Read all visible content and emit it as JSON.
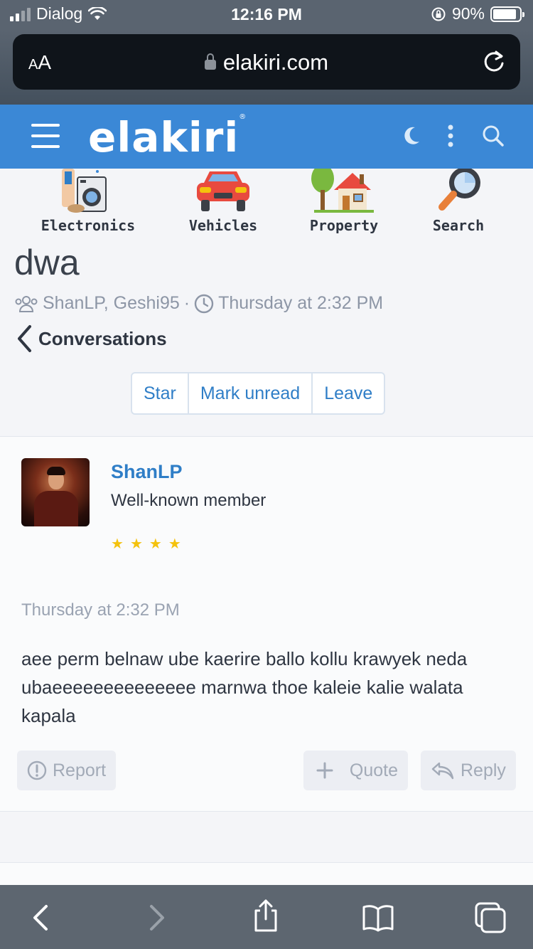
{
  "status_bar": {
    "carrier": "Dialog",
    "time": "12:16 PM",
    "battery": "90%",
    "battery_level": 0.9
  },
  "browser": {
    "text_size_label_small": "A",
    "text_size_label_large": "A",
    "url": "elakiri.com"
  },
  "site": {
    "logo": "elakiri",
    "logo_mark": "®",
    "categories": [
      {
        "label": "Electronics",
        "icon": "electronics-icon"
      },
      {
        "label": "Vehicles",
        "icon": "car-icon"
      },
      {
        "label": "Property",
        "icon": "house-icon"
      },
      {
        "label": "Search",
        "icon": "magnifier-icon"
      }
    ]
  },
  "thread": {
    "title": "dwa",
    "participants": "ShanLP, Geshi95",
    "separator": "·",
    "date": "Thursday at 2:32 PM",
    "back_label": "Conversations",
    "actions": [
      "Star",
      "Mark unread",
      "Leave"
    ]
  },
  "post": {
    "author": "ShanLP",
    "author_title": "Well-known member",
    "rating_stars": 4,
    "date": "Thursday at 2:32 PM",
    "body": "aee perm belnaw ube kaerire ballo kollu krawyek neda ubaeeeeeeeeeeeeee marnwa thoe kaleie kalie walata kapala",
    "buttons": {
      "report": "Report",
      "quote": "Quote",
      "reply": "Reply"
    }
  },
  "colors": {
    "header_blue": "#3b88d6",
    "link_blue": "#2f7ec7",
    "star_gold": "#f4c20d"
  }
}
